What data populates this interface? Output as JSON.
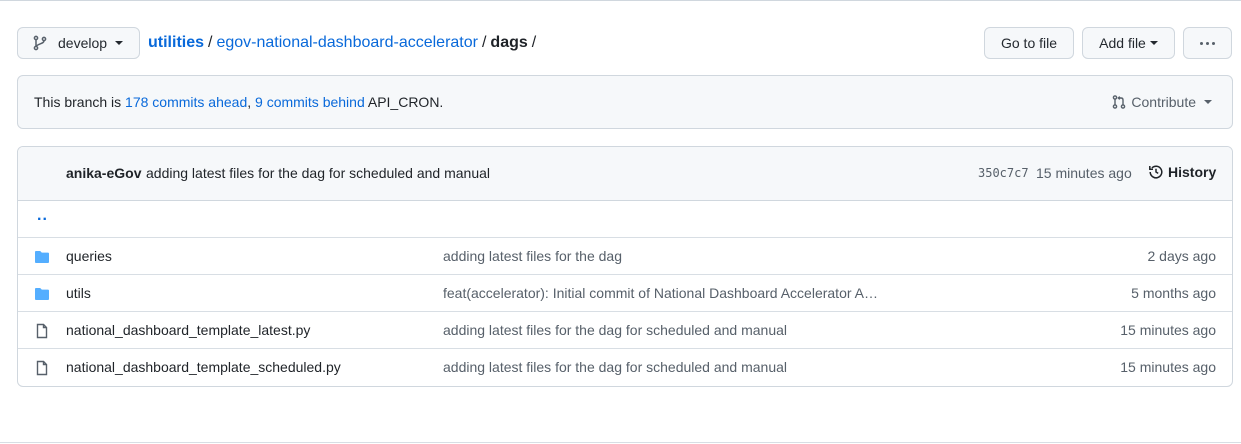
{
  "branch": {
    "name": "develop"
  },
  "breadcrumb": {
    "root": "utilities",
    "repo": "egov-national-dashboard-accelerator",
    "current": "dags",
    "separator": "/"
  },
  "actions": {
    "go_to_file": "Go to file",
    "add_file": "Add file"
  },
  "branch_status": {
    "prefix": "This branch is ",
    "ahead": "178 commits ahead",
    "comma": ", ",
    "behind": "9 commits behind",
    "target": " API_CRON.",
    "contribute": "Contribute"
  },
  "latest_commit": {
    "author": "anika-eGov",
    "message": "adding latest files for the dag for scheduled and manual",
    "sha": "350c7c7",
    "time": "15 minutes ago",
    "history_label": "History"
  },
  "parent_dir": "..",
  "files": [
    {
      "type": "folder",
      "name": "queries",
      "message": "adding latest files for the dag",
      "age": "2 days ago"
    },
    {
      "type": "folder",
      "name": "utils",
      "message": "feat(accelerator): Initial commit of National Dashboard Accelerator A…",
      "age": "5 months ago"
    },
    {
      "type": "file",
      "name": "national_dashboard_template_latest.py",
      "message": "adding latest files for the dag for scheduled and manual",
      "age": "15 minutes ago"
    },
    {
      "type": "file",
      "name": "national_dashboard_template_scheduled.py",
      "message": "adding latest files for the dag for scheduled and manual",
      "age": "15 minutes ago"
    }
  ],
  "colors": {
    "link": "#0969da",
    "folder": "#54aeff",
    "muted": "#57606a",
    "border": "#d0d7de"
  }
}
